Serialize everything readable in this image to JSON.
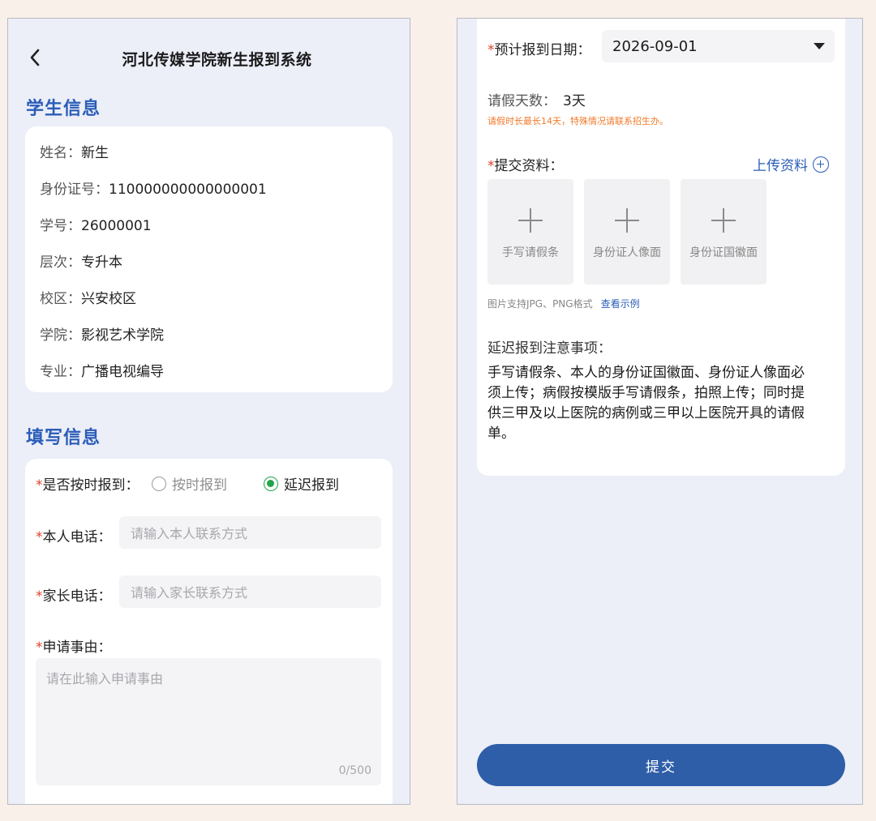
{
  "left": {
    "header": {
      "title": "河北传媒学院新生报到系统"
    },
    "student_info": {
      "section_title": "学生信息",
      "rows": [
        {
          "label": "姓名：",
          "value": "新生"
        },
        {
          "label": "身份证号：",
          "value": "110000000000000001"
        },
        {
          "label": "学号：",
          "value": "26000001"
        },
        {
          "label": "层次：",
          "value": "专升本"
        },
        {
          "label": "校区：",
          "value": "兴安校区"
        },
        {
          "label": "学院：",
          "value": "影视艺术学院"
        },
        {
          "label": "专业：",
          "value": "广播电视编导"
        }
      ]
    },
    "fill_info": {
      "section_title": "填写信息",
      "required_mark": "*",
      "on_time": {
        "label": "是否按时报到：",
        "options": [
          {
            "label": "按时报到",
            "selected": false
          },
          {
            "label": "延迟报到",
            "selected": true
          }
        ]
      },
      "phone": {
        "label": "本人电话：",
        "placeholder": "请输入本人联系方式"
      },
      "parent_phone": {
        "label": "家长电话：",
        "placeholder": "请输入家长联系方式"
      },
      "reason": {
        "label": "申请事由：",
        "placeholder": "请在此输入申请事由",
        "counter": "0/500"
      }
    }
  },
  "right": {
    "required_mark": "*",
    "expected_date": {
      "label": "预计报到日期：",
      "value": "2026-09-01"
    },
    "leave_days": {
      "label": "请假天数：",
      "value": "3天",
      "note": "请假时长最长14天，特殊情况请联系招生办。"
    },
    "materials": {
      "label": "提交资料：",
      "upload_link": "上传资料",
      "boxes": [
        "手写请假条",
        "身份证人像面",
        "身份证国徽面"
      ],
      "tip": "图片支持JPG、PNG格式",
      "example_link": "查看示例"
    },
    "notice": {
      "title": "延迟报到注意事项：",
      "lines": [
        "手写请假条、本人的身份证国徽面、身份证人像面必",
        "须上传；病假按模版手写请假条，拍照上传；同时提",
        "供三甲及以上医院的病例或三甲以上医院开具的请假",
        "单。"
      ]
    },
    "submit_label": "提交"
  },
  "colors": {
    "accent": "#2a5db8",
    "required": "#e0432c",
    "radio_selected": "#22a44a",
    "button": "#2f5ea8",
    "note": "#f07a2a"
  }
}
